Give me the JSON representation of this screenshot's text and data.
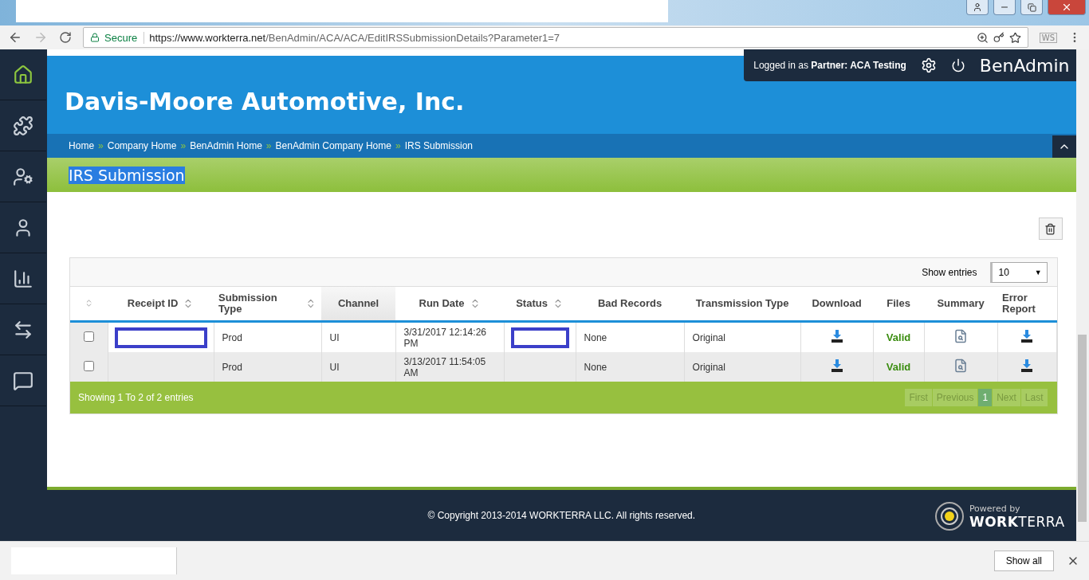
{
  "browser": {
    "secure_label": "Secure",
    "url_host": "https://www.workterra.net",
    "url_path": "/BenAdmin/ACA/ACA/EditIRSSubmissionDetails?Parameter1=7",
    "extension": "WS"
  },
  "topbar": {
    "login": "Logged in as **Partner:  ACA Testing**",
    "app": "BenAdmin"
  },
  "sidebar": {
    "items": [
      {
        "selected": true
      },
      {
        "selected": false
      },
      {
        "selected": false
      },
      {
        "selected": false
      },
      {
        "selected": false
      },
      {
        "selected": false
      },
      {
        "selected": false
      }
    ]
  },
  "company": "Davis-Moore Automotive, Inc.",
  "breadcrumb": {
    "separator": "»",
    "items": [
      "Home",
      "Company Home",
      "BenAdmin Home",
      "BenAdmin Company Home",
      "IRS Submission"
    ]
  },
  "page_title": {
    "text": "IRS Submission",
    "highlighted": true
  },
  "table": {
    "show_entries_label": "Show entries",
    "page_size": "10",
    "page_size_caret": "▼",
    "select_column": {
      "sortable": true
    },
    "columns": [
      {
        "label": "Receipt ID",
        "sortable": true,
        "selected": false
      },
      {
        "label": "Submission Type",
        "sortable": true,
        "selected": false
      },
      {
        "label": "Channel",
        "sortable": false,
        "selected": true
      },
      {
        "label": "Run Date",
        "sortable": true,
        "selected": false
      },
      {
        "label": "Status",
        "sortable": true,
        "selected": false
      },
      {
        "label": "Bad Records",
        "sortable": false,
        "selected": false
      },
      {
        "label": "Transmission Type",
        "sortable": false,
        "selected": false
      },
      {
        "label": "Download",
        "sortable": false,
        "selected": false
      },
      {
        "label": "Files",
        "sortable": false,
        "selected": false
      },
      {
        "label": "Summary",
        "sortable": false,
        "selected": false
      },
      {
        "label": "Error Report",
        "sortable": false,
        "selected": false
      }
    ],
    "rows": [
      {
        "checked": false,
        "receipt_redacted": true,
        "submission_type": "Prod",
        "channel": "UI",
        "run_date": "3/31/2017 12:14:26 PM",
        "status_redacted": true,
        "bad_records": "None",
        "transmission_type": "Original",
        "files": "Valid"
      },
      {
        "checked": false,
        "receipt_redacted": false,
        "submission_type": "Prod",
        "channel": "UI",
        "run_date": "3/13/2017 11:54:05 AM",
        "status_redacted": false,
        "bad_records": "None",
        "transmission_type": "Original",
        "files": "Valid"
      }
    ],
    "info": "Showing 1 To 2 of 2 entries",
    "pagination": [
      {
        "label": "First",
        "selected": false
      },
      {
        "label": "Previous",
        "selected": false
      },
      {
        "label": "1",
        "selected": true
      },
      {
        "label": "Next",
        "selected": false
      },
      {
        "label": "Last",
        "selected": false
      }
    ]
  },
  "footer": {
    "copyright": "© Copyright 2013-2014 WORKTERRA LLC. All rights reserved.",
    "powered_by": "Powered by",
    "brand": "**WORK**TERRA"
  },
  "download_bar": {
    "show_all": "Show all"
  }
}
